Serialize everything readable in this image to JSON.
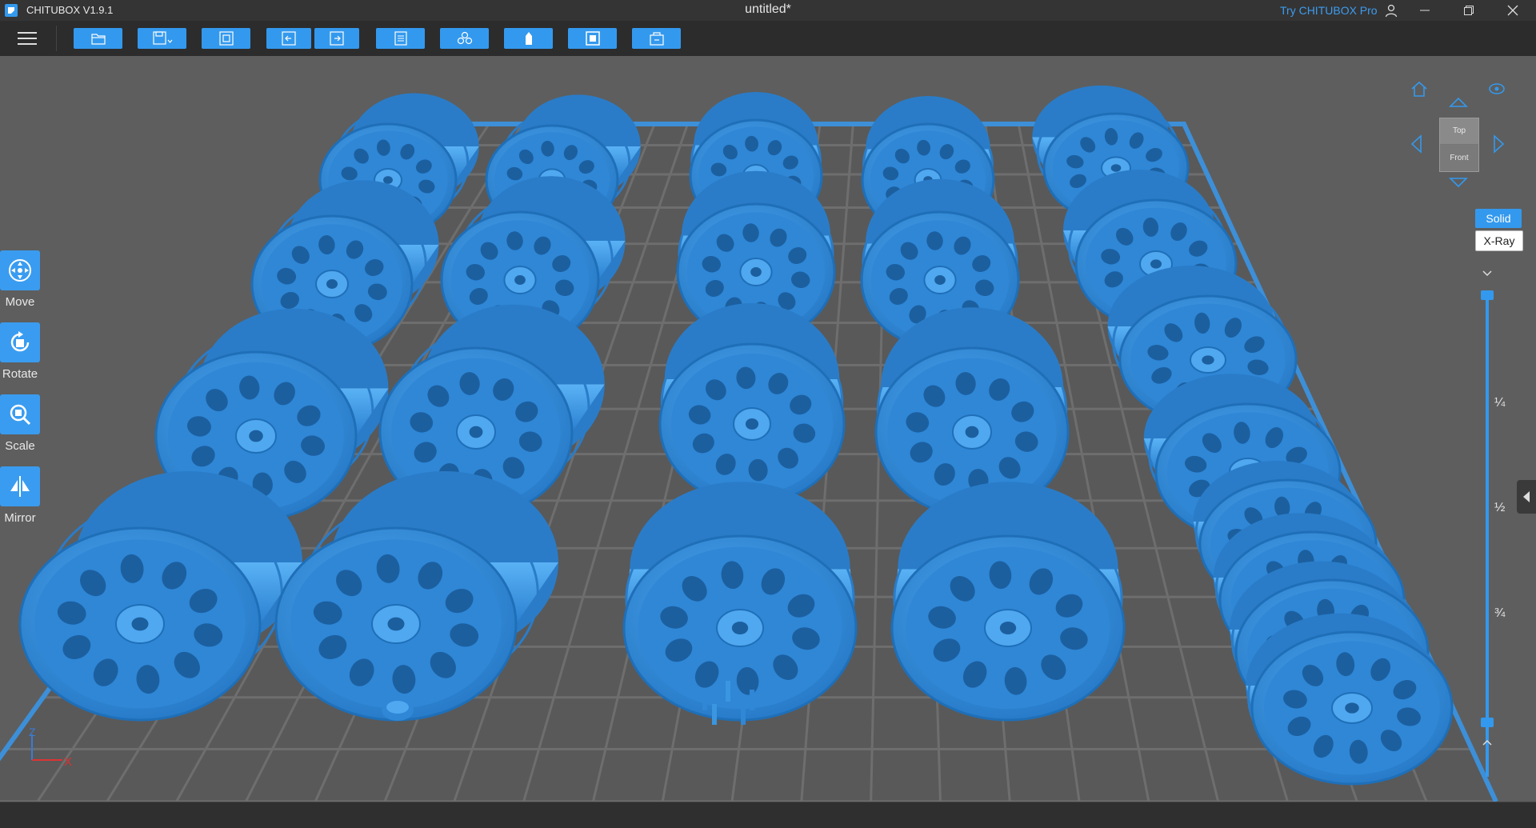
{
  "titlebar": {
    "app_name": "CHITUBOX V1.9.1",
    "document_title": "untitled*",
    "try_pro_link": "Try CHITUBOX Pro"
  },
  "toolbar": {
    "buttons": [
      {
        "icon": "folder-open-icon"
      },
      {
        "icon": "save-icon"
      },
      {
        "icon": "screenshot-icon"
      },
      {
        "icon": "undo-icon"
      },
      {
        "icon": "redo-icon"
      },
      {
        "icon": "list-icon"
      },
      {
        "icon": "auto-layout-icon"
      },
      {
        "icon": "support-icon"
      },
      {
        "icon": "hollow-icon"
      },
      {
        "icon": "slice-icon"
      }
    ]
  },
  "left_tools": [
    {
      "label": "Move",
      "icon": "move-icon"
    },
    {
      "label": "Rotate",
      "icon": "rotate-icon"
    },
    {
      "label": "Scale",
      "icon": "scale-icon"
    },
    {
      "label": "Mirror",
      "icon": "mirror-icon"
    }
  ],
  "view_cube": {
    "top_label": "Top",
    "front_label": "Front"
  },
  "render_modes": {
    "solid": "Solid",
    "xray": "X-Ray",
    "active": "Solid"
  },
  "layer_slider": {
    "fractions": [
      "¼",
      "½",
      "¾"
    ]
  },
  "axis": {
    "z": "Z",
    "x": "X"
  },
  "colors": {
    "accent": "#3399ee",
    "model": "#2f87d6",
    "model_highlight": "#4fa8f0",
    "plate_grid": "#6e6e6e",
    "background": "#5e5e5e"
  }
}
